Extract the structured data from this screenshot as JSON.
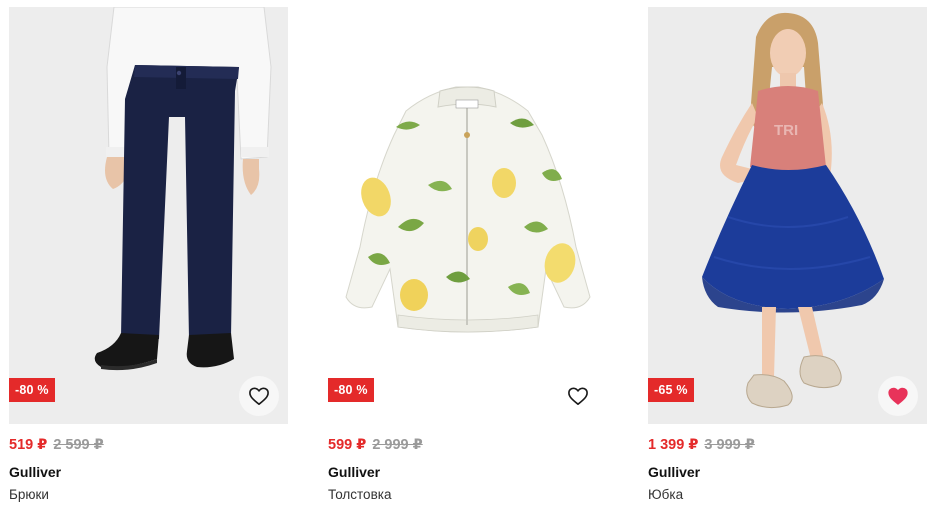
{
  "products": [
    {
      "discount": "-80 %",
      "price_now": "519 ₽",
      "price_old": "2 599 ₽",
      "brand": "Gulliver",
      "title": "Брюки",
      "favorited": false,
      "icon": "heart-outline-icon"
    },
    {
      "discount": "-80 %",
      "price_now": "599 ₽",
      "price_old": "2 999 ₽",
      "brand": "Gulliver",
      "title": "Толстовка",
      "favorited": false,
      "icon": "heart-outline-icon"
    },
    {
      "discount": "-65 %",
      "price_now": "1 399 ₽",
      "price_old": "3 999 ₽",
      "brand": "Gulliver",
      "title": "Юбка",
      "favorited": true,
      "icon": "heart-filled-icon"
    }
  ],
  "colors": {
    "accent": "#e42a2a",
    "old_price": "#9a9a9a",
    "favorite": "#e8335a"
  }
}
